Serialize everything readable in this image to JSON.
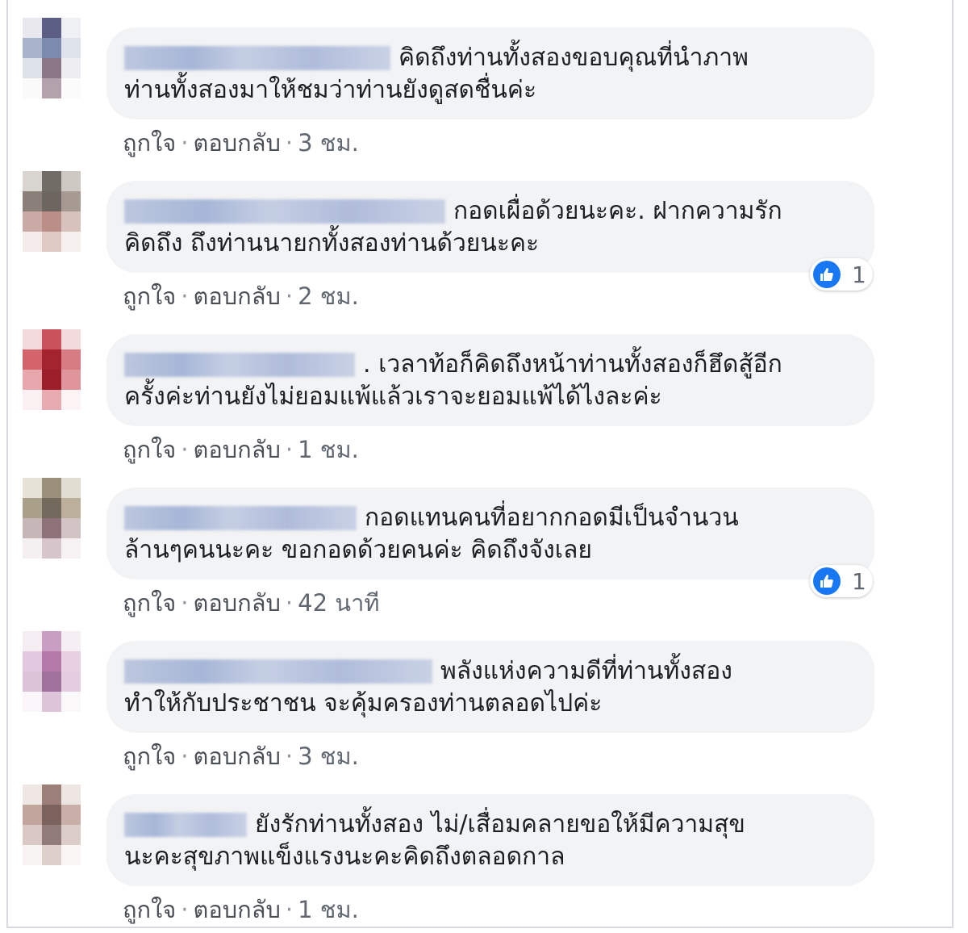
{
  "labels": {
    "like": "ถูกใจ",
    "reply": "ตอบกลับ"
  },
  "colors": {
    "bubble": "#f2f3f5",
    "like_badge": "#1877f2",
    "meta_text": "#606770"
  },
  "comments": [
    {
      "line1": "คิดถึงท่านทั้งสองขอบคุณที่นำภาพ",
      "line2": "ท่านทั้งสองมาให้ชมว่าท่านยังดูสดชื่นค่ะ",
      "time": "3 ชม.",
      "reactions": null
    },
    {
      "line1": "กอดเผื่อด้วยนะคะ. ฝากความรัก",
      "line2": "คิดถึง ถึงท่านนายกทั้งสองท่านด้วยนะคะ",
      "time": "2 ชม.",
      "reactions": "1"
    },
    {
      "line1": ". เวลาท้อก็คิดถึงหน้าท่านทั้งสองก็ฮึดสู้อีก",
      "line2": "ครั้งค่ะท่านยังไม่ยอมแพ้แล้วเราจะยอมแพ้ได้ไงละค่ะ",
      "time": "1 ชม.",
      "reactions": null
    },
    {
      "line1": "กอดแทนคนที่อยากกอดมีเป็นจำนวน",
      "line2": "ล้านๆคนนะคะ ขอกอดด้วยคนค่ะ คิดถึงจังเลย",
      "time": "42 นาที",
      "reactions": "1"
    },
    {
      "line1": "พลังแห่งความดีที่ท่านทั้งสอง",
      "line2": "ทำให้กับประชาชน จะคุ้มครองท่านตลอดไปค่ะ",
      "time": "3 ชม.",
      "reactions": null
    },
    {
      "line1": "ยังรักท่านทั้งสอง ไม่/เสื่อมคลายขอให้มีความสุข",
      "line2": "นะคะสุขภาพแข็งแรงนะคะคิดถึงตลอดกาล",
      "time": "1 ชม.",
      "reactions": null
    }
  ]
}
